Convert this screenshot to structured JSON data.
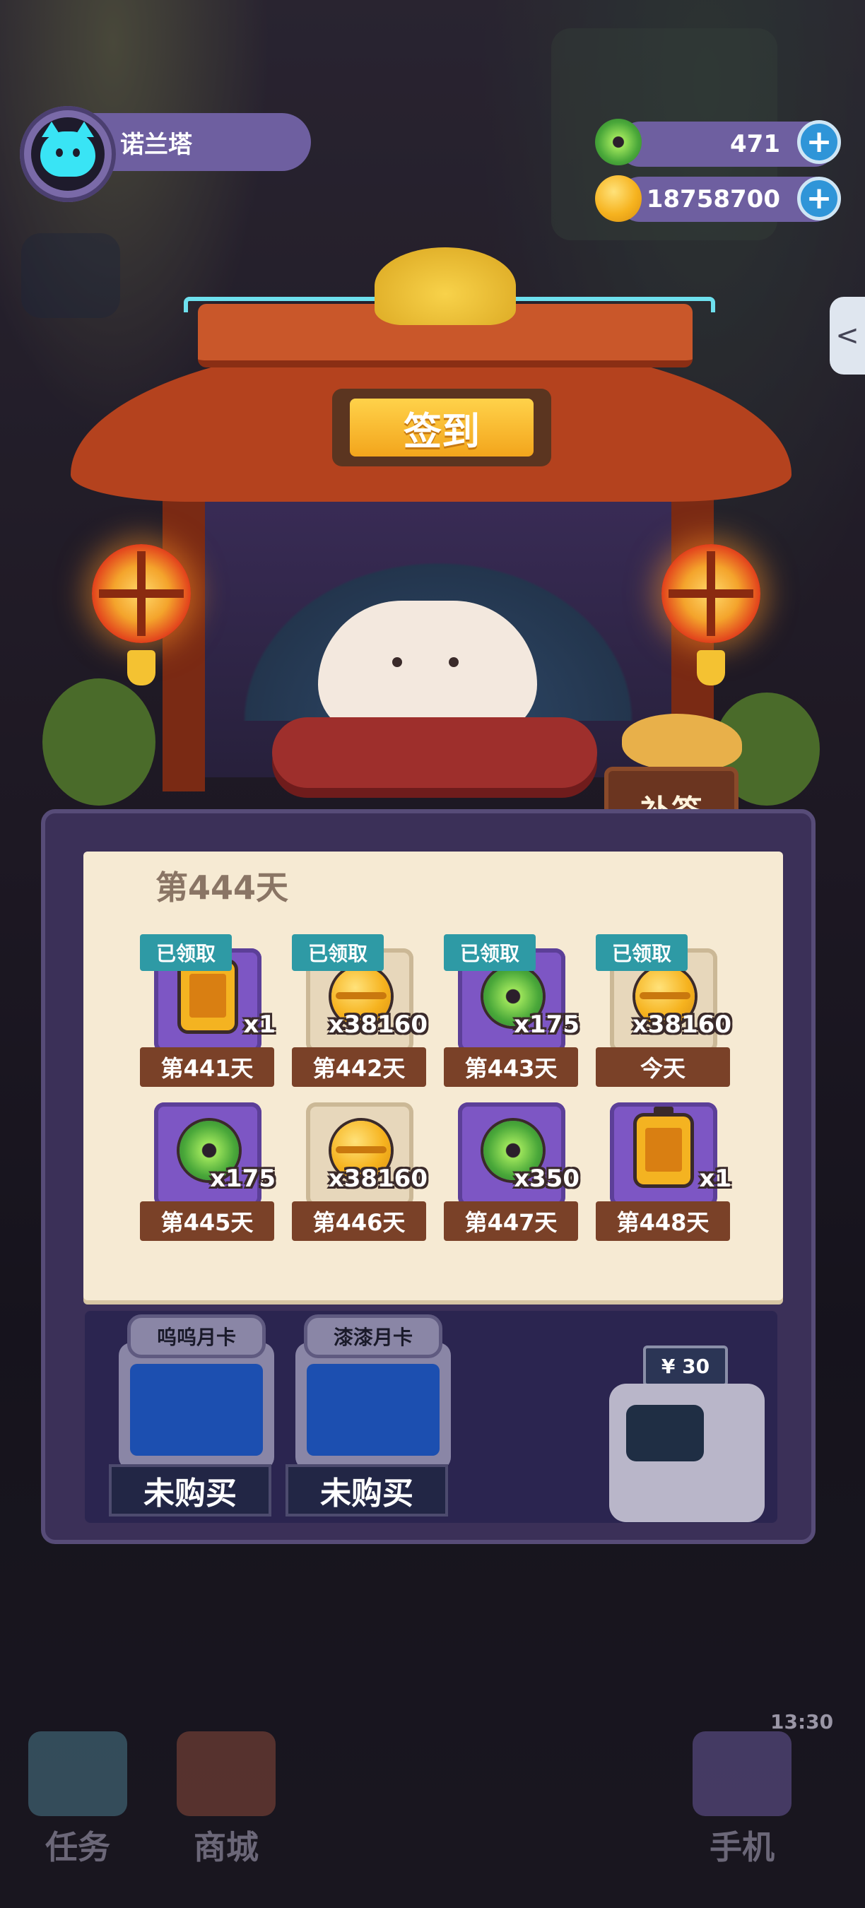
{
  "player": {
    "name": "诺兰塔"
  },
  "currencies": {
    "jade": {
      "amount": "471"
    },
    "gold": {
      "amount": "18758700"
    }
  },
  "header": {
    "checkin_title": "签到",
    "makeup_button": "补签"
  },
  "calendar": {
    "day_title": "第444天",
    "claimed_label": "已领取",
    "rewards": [
      {
        "day": "第441天",
        "icon": "battery-icon",
        "qty": "x1",
        "claimed": true,
        "tile": "purple"
      },
      {
        "day": "第442天",
        "icon": "gold-coin-icon",
        "qty": "x38160",
        "claimed": true,
        "tile": "beige"
      },
      {
        "day": "第443天",
        "icon": "jade-coin-icon",
        "qty": "x175",
        "claimed": true,
        "tile": "purple"
      },
      {
        "day": "今天",
        "icon": "gold-coin-icon",
        "qty": "x38160",
        "claimed": true,
        "tile": "beige"
      },
      {
        "day": "第445天",
        "icon": "jade-coin-icon",
        "qty": "x175",
        "claimed": false,
        "tile": "purple"
      },
      {
        "day": "第446天",
        "icon": "gold-coin-icon",
        "qty": "x38160",
        "claimed": false,
        "tile": "beige"
      },
      {
        "day": "第447天",
        "icon": "jade-coin-icon",
        "qty": "x350",
        "claimed": false,
        "tile": "purple"
      },
      {
        "day": "第448天",
        "icon": "battery-icon",
        "qty": "x1",
        "claimed": false,
        "tile": "purple"
      }
    ]
  },
  "monthly_cards": [
    {
      "name": "呜呜月卡",
      "status": "未购买"
    },
    {
      "name": "漆漆月卡",
      "status": "未购买"
    }
  ],
  "vending": {
    "price": "¥ 30"
  },
  "nav": {
    "tasks": "任务",
    "shop": "商城",
    "phone": "手机"
  },
  "background": {
    "clock": "13:30"
  }
}
